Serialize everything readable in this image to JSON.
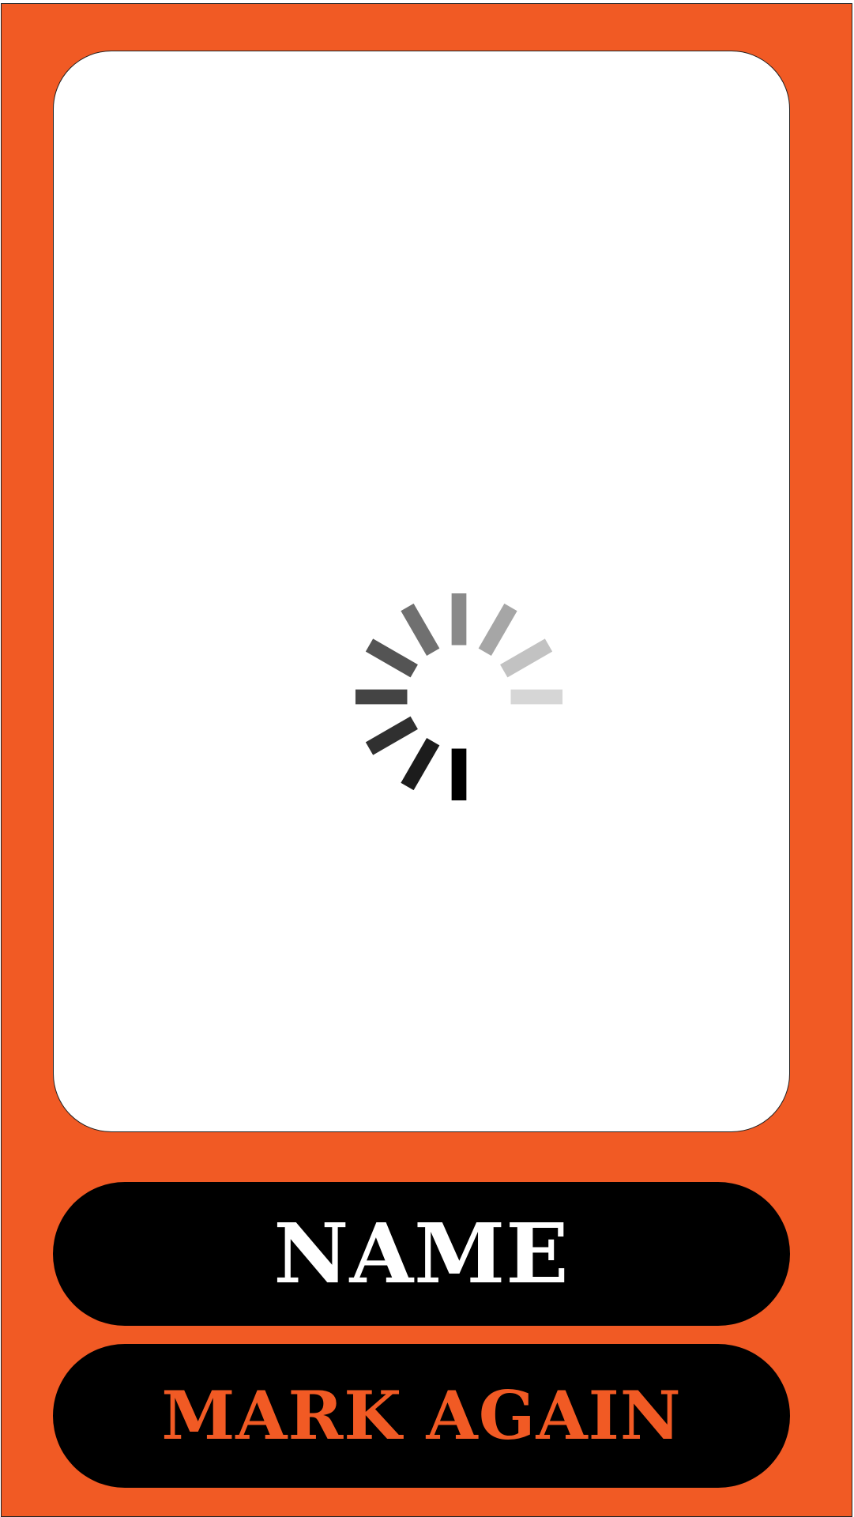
{
  "colors": {
    "background": "#f15a24",
    "card": "#ffffff",
    "button": "#000000",
    "name_text": "#ffffff",
    "mark_text": "#f15a24"
  },
  "card": {
    "loading_icon": "loading-spinner-icon"
  },
  "buttons": {
    "name_label": "NAME",
    "mark_again_label": "MARK AGAIN"
  }
}
